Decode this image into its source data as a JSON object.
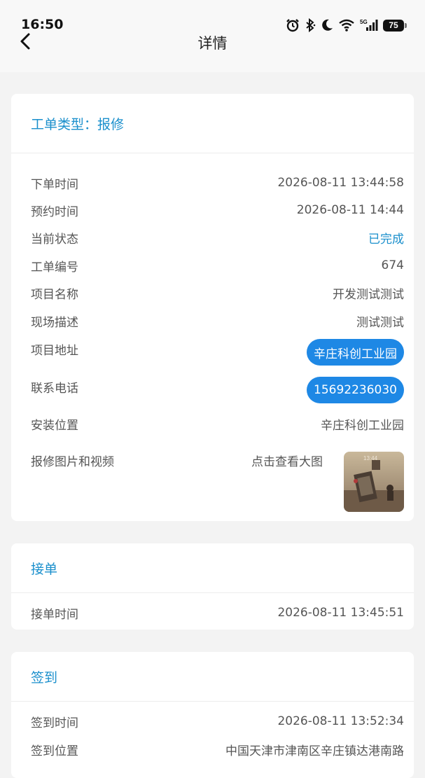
{
  "status_bar": {
    "time": "16:50",
    "battery": "75"
  },
  "header": {
    "title": "详情"
  },
  "order_card": {
    "title": "工单类型：报修",
    "rows": [
      {
        "label": "下单时间",
        "value": "2026-08-11 13:44:58"
      },
      {
        "label": "预约时间",
        "value": "2026-08-11 14:44"
      },
      {
        "label": "当前状态",
        "value": "已完成"
      },
      {
        "label": "工单编号",
        "value": "674"
      },
      {
        "label": "项目名称",
        "value": "开发测试测试"
      },
      {
        "label": "现场描述",
        "value": "测试测试"
      },
      {
        "label": "项目地址",
        "value": "辛庄科创工业园"
      },
      {
        "label": "联系电话",
        "value": "15692236030"
      },
      {
        "label": "安装位置",
        "value": "辛庄科创工业园"
      },
      {
        "label": "报修图片和视频",
        "value": "点击查看大图"
      }
    ]
  },
  "accept_card": {
    "title": "接单",
    "rows": [
      {
        "label": "接单时间",
        "value": "2026-08-11 13:45:51"
      }
    ]
  },
  "checkin_card": {
    "title": "签到",
    "rows": [
      {
        "label": "签到时间",
        "value": "2026-08-11 13:52:34"
      },
      {
        "label": "签到位置",
        "value": "中国天津市津南区辛庄镇达港南路"
      }
    ]
  },
  "colors": {
    "accent": "#1a8fcc",
    "pill": "#1e88e5",
    "background": "#f3f3f3"
  }
}
